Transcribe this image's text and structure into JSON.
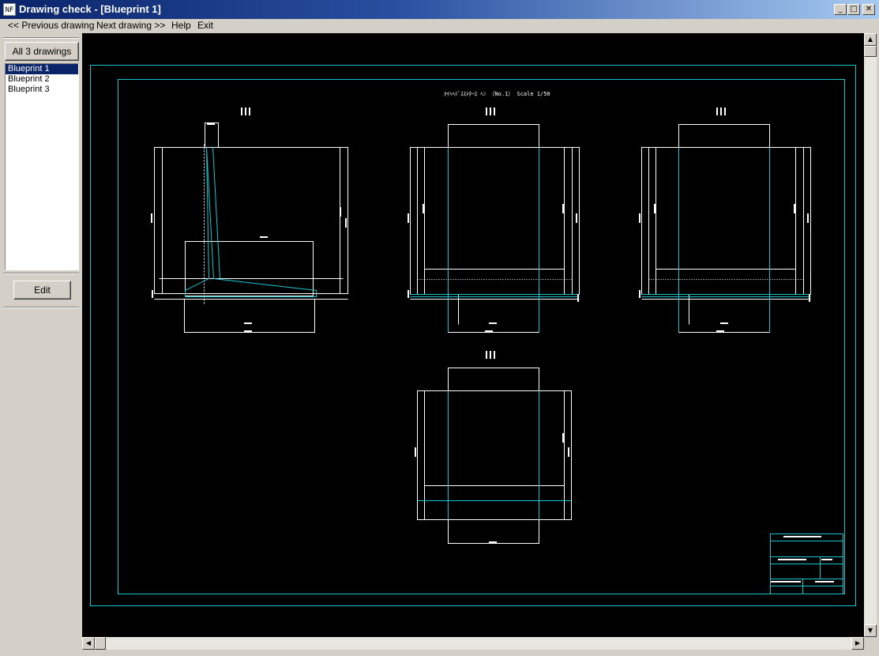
{
  "window": {
    "title": "Drawing check - [Blueprint 1]",
    "icon_text": "NF"
  },
  "window_buttons": {
    "minimize": "_",
    "maximize": "□",
    "close": "✕"
  },
  "menu": {
    "prev": "<< Previous drawing",
    "next": "Next drawing >>",
    "help": "Help",
    "exit": "Exit"
  },
  "sidebar": {
    "all_button": "All 3 drawings",
    "items": [
      "Blueprint 1",
      "Blueprint 2",
      "Blueprint 3"
    ],
    "selected": 0,
    "edit_button": "Edit"
  },
  "drawing": {
    "heading": "ｵｲﾍﾍﾃﾞｽｽﾒﾀｰﾛ ﾍﾝ （No.1） Scale  1/50",
    "colors": {
      "frame": "#19c5cc",
      "line": "#ffffff",
      "background": "#000000"
    }
  },
  "scroll": {
    "up": "▲",
    "down": "▼",
    "left": "◀",
    "right": "▶"
  }
}
